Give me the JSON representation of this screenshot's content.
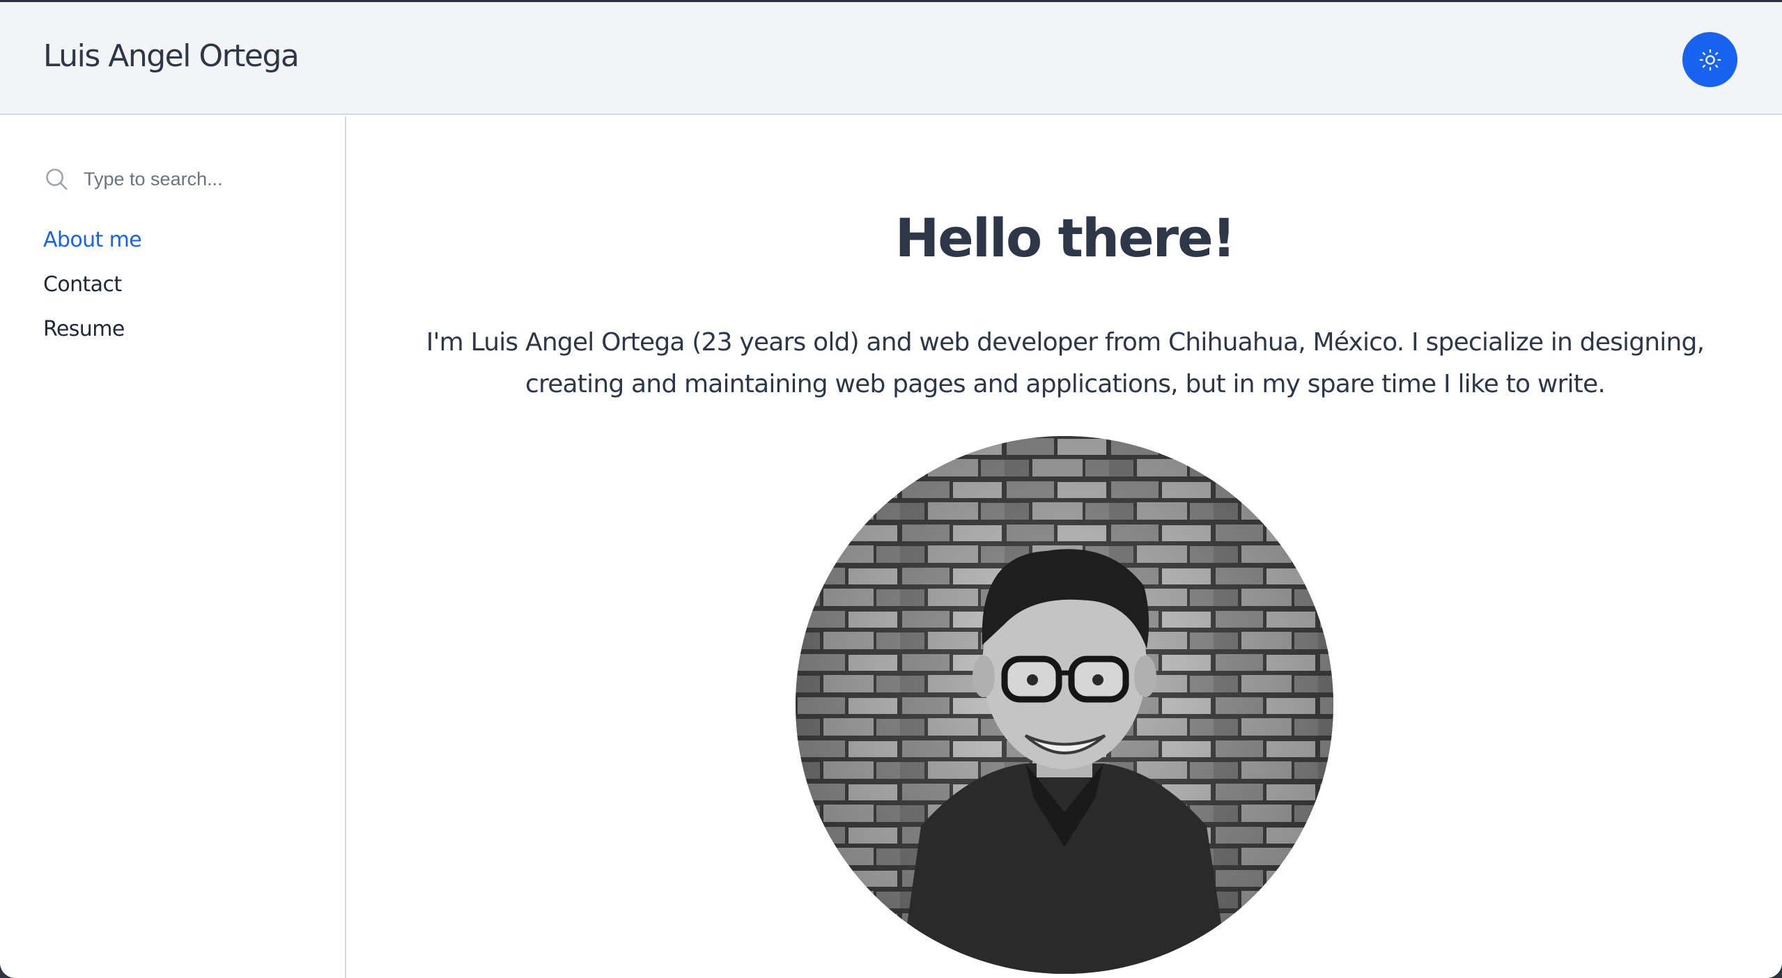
{
  "header": {
    "site_title": "Luis Angel Ortega",
    "theme_toggle_icon": "sun-icon",
    "accent_color": "#1763f0"
  },
  "sidebar": {
    "search": {
      "placeholder": "Type to search...",
      "value": "",
      "icon": "search-icon"
    },
    "items": [
      {
        "label": "About me",
        "active": true
      },
      {
        "label": "Contact",
        "active": false
      },
      {
        "label": "Resume",
        "active": false
      }
    ]
  },
  "main": {
    "heading": "Hello there!",
    "intro": "I'm Luis Angel Ortega (23 years old) and web developer from Chihuahua, México. I specialize in designing, creating and maintaining web pages and applications, but in my spare time I like to write.",
    "avatar": "profile-photo"
  },
  "colors": {
    "text": "#2d3748",
    "header_bg": "#f3f4f6",
    "border": "#d6dbe2",
    "link_active": "#1763f0"
  }
}
